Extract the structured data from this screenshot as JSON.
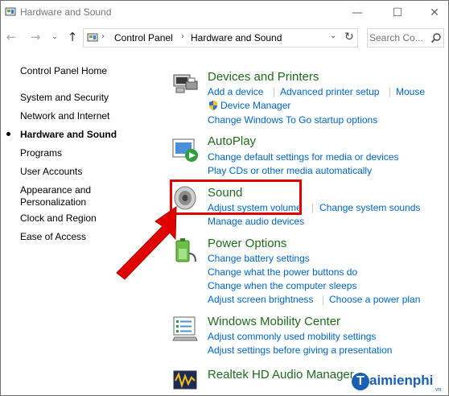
{
  "window": {
    "title": "Hardware and Sound",
    "minimize": "—",
    "maximize": "☐",
    "close": "✕"
  },
  "nav": {
    "back": "←",
    "forward": "→",
    "recent": "⌄",
    "up": "↑",
    "breadcrumbs": [
      "Control Panel",
      "Hardware and Sound"
    ],
    "separator": "›",
    "dropdown": "⌄",
    "refresh": "↻",
    "search_placeholder": "Search Co..."
  },
  "sidebar": {
    "items": [
      {
        "label": "Control Panel Home"
      },
      {
        "label": "System and Security"
      },
      {
        "label": "Network and Internet"
      },
      {
        "label": "Hardware and Sound",
        "active": true
      },
      {
        "label": "Programs"
      },
      {
        "label": "User Accounts"
      },
      {
        "label": "Appearance and"
      },
      {
        "label": "Personalization"
      },
      {
        "label": "Clock and Region"
      },
      {
        "label": "Ease of Access"
      }
    ]
  },
  "categories": {
    "devices": {
      "title": "Devices and Printers",
      "links": [
        "Add a device",
        "Advanced printer setup",
        "Mouse",
        "Device Manager",
        "Change Windows To Go startup options"
      ]
    },
    "autoplay": {
      "title": "AutoPlay",
      "links": [
        "Change default settings for media or devices",
        "Play CDs or other media automatically"
      ]
    },
    "sound": {
      "title": "Sound",
      "links": [
        "Adjust system volume",
        "Change system sounds",
        "Manage audio devices"
      ]
    },
    "power": {
      "title": "Power Options",
      "links": [
        "Change battery settings",
        "Change what the power buttons do",
        "Change when the computer sleeps",
        "Adjust screen brightness",
        "Choose a power plan"
      ]
    },
    "mobility": {
      "title": "Windows Mobility Center",
      "links": [
        "Adjust commonly used mobility settings",
        "Adjust settings before giving a presentation"
      ]
    },
    "realtek": {
      "title": "Realtek HD Audio Manager"
    }
  },
  "watermark": {
    "brand": "aimienphi",
    "letter": "T",
    "suffix": ".vn"
  },
  "colors": {
    "category_title": "#1e6b1e",
    "link": "#0066cc",
    "highlight": "#e00000",
    "watermark": "#1a5fb4"
  }
}
